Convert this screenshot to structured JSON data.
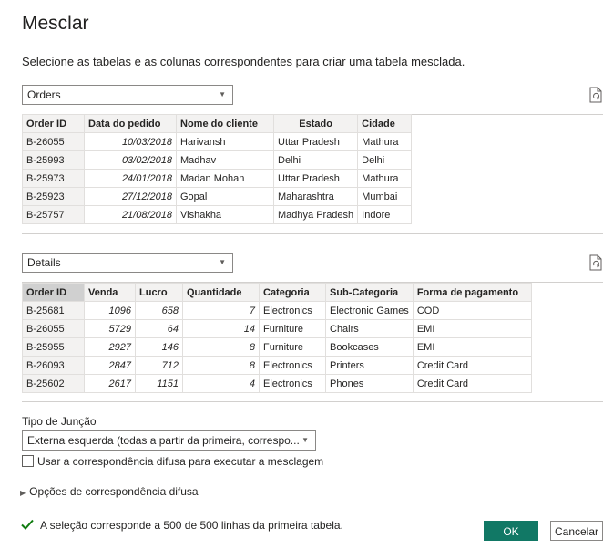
{
  "dialog": {
    "title": "Mesclar",
    "subtitle": "Selecione as tabelas e as colunas correspondentes para criar uma tabela mesclada."
  },
  "table1": {
    "selected": "Orders",
    "headers": [
      "Order ID",
      "Data do pedido",
      "Nome do cliente",
      "Estado",
      "Cidade"
    ],
    "rows": [
      [
        "B-26055",
        "10/03/2018",
        "Harivansh",
        "Uttar Pradesh",
        "Mathura"
      ],
      [
        "B-25993",
        "03/02/2018",
        "Madhav",
        "Delhi",
        "Delhi"
      ],
      [
        "B-25973",
        "24/01/2018",
        "Madan Mohan",
        "Uttar Pradesh",
        "Mathura"
      ],
      [
        "B-25923",
        "27/12/2018",
        "Gopal",
        "Maharashtra",
        "Mumbai"
      ],
      [
        "B-25757",
        "21/08/2018",
        "Vishakha",
        "Madhya Pradesh",
        "Indore"
      ]
    ]
  },
  "table2": {
    "selected": "Details",
    "headers": [
      "Order ID",
      "Venda",
      "Lucro",
      "Quantidade",
      "Categoria",
      "Sub-Categoria",
      "Forma de pagamento"
    ],
    "rows": [
      [
        "B-25681",
        "1096",
        "658",
        "7",
        "Electronics",
        "Electronic Games",
        "COD"
      ],
      [
        "B-26055",
        "5729",
        "64",
        "14",
        "Furniture",
        "Chairs",
        "EMI"
      ],
      [
        "B-25955",
        "2927",
        "146",
        "8",
        "Furniture",
        "Bookcases",
        "EMI"
      ],
      [
        "B-26093",
        "2847",
        "712",
        "8",
        "Electronics",
        "Printers",
        "Credit Card"
      ],
      [
        "B-25602",
        "2617",
        "1151",
        "4",
        "Electronics",
        "Phones",
        "Credit Card"
      ]
    ]
  },
  "join": {
    "label": "Tipo de Junção",
    "selected": "Externa esquerda (todas a partir da primeira, correspo...",
    "fuzzy_checkbox_label": "Usar a correspondência difusa para executar a mesclagem",
    "fuzzy_checked": false,
    "fuzzy_options_label": "Opções de correspondência difusa"
  },
  "status": {
    "text": "A seleção corresponde a 500 de 500 linhas da primeira tabela."
  },
  "buttons": {
    "ok": "OK",
    "cancel": "Cancelar"
  },
  "colors": {
    "accent": "#117865",
    "check": "#107c10",
    "key_column_header": "#d0d0d0"
  }
}
